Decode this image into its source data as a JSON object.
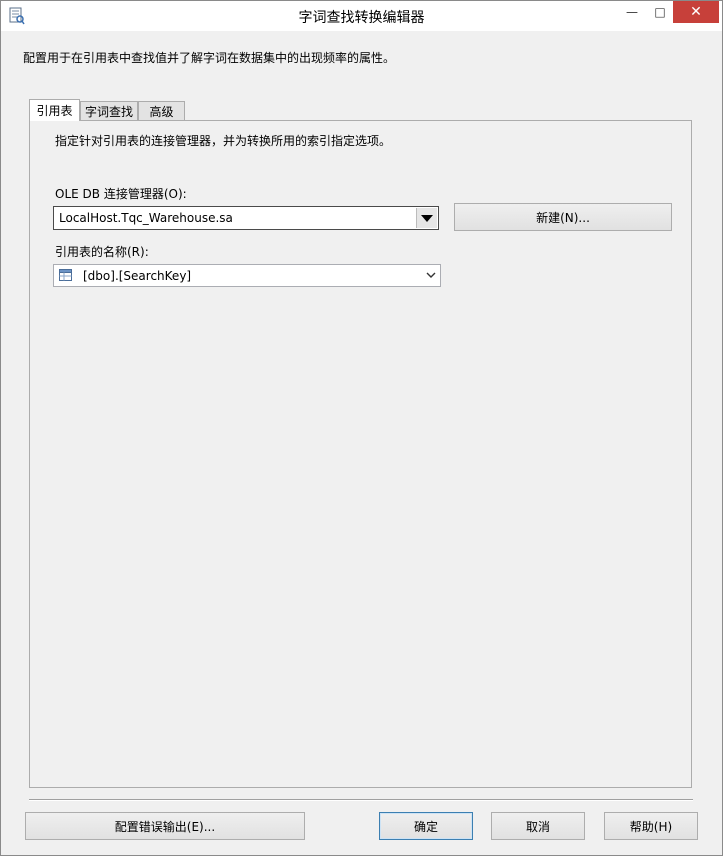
{
  "window": {
    "title": "字词查找转换编辑器",
    "controls": {
      "minimize": "—",
      "maximize": "□",
      "close": "✕"
    }
  },
  "description": "配置用于在引用表中查找值并了解字词在数据集中的出现频率的属性。",
  "tabs": [
    {
      "label": "引用表",
      "active": true
    },
    {
      "label": "字词查找",
      "active": false
    },
    {
      "label": "高级",
      "active": false
    }
  ],
  "reference_tab": {
    "description": "指定针对引用表的连接管理器，并为转换所用的索引指定选项。",
    "oledb_label": "OLE DB 连接管理器(O):",
    "oledb_value": "LocalHost.Tqc_Warehouse.sa",
    "new_button": "新建(N)...",
    "table_label": "引用表的名称(R):",
    "table_value": "[dbo].[SearchKey]"
  },
  "footer": {
    "error_output_button": "配置错误输出(E)...",
    "ok_button": "确定",
    "cancel_button": "取消",
    "help_button": "帮助(H)"
  },
  "colors": {
    "close_button": "#c7403a",
    "window_bg": "#f0f0f0",
    "default_button_border": "#3c7fb1"
  }
}
